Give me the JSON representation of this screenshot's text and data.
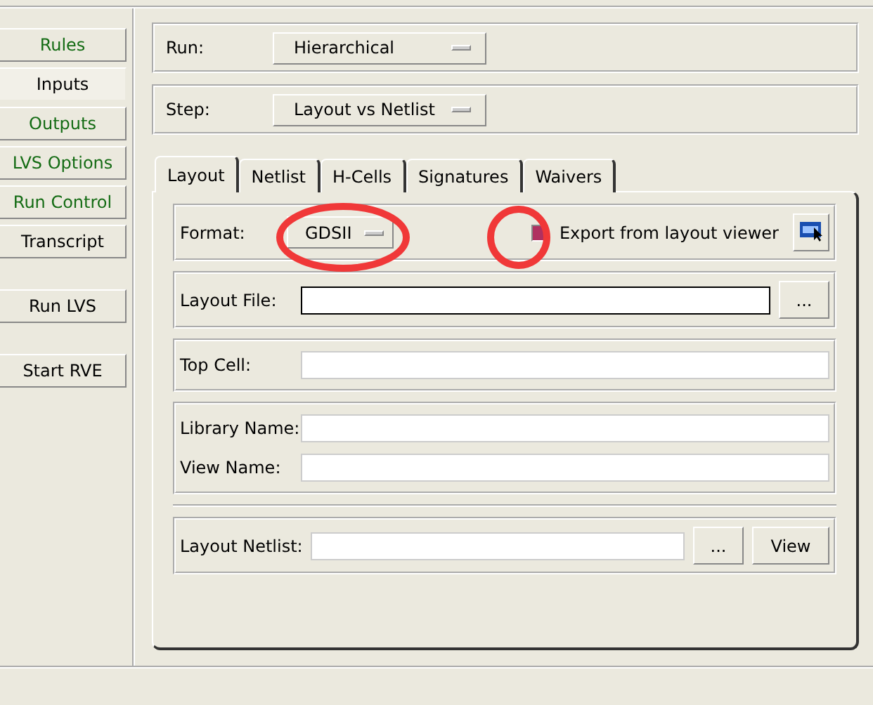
{
  "sidebar": {
    "items": [
      {
        "label": "Rules",
        "selected": false,
        "configured": true
      },
      {
        "label": "Inputs",
        "selected": true,
        "configured": false
      },
      {
        "label": "Outputs",
        "selected": false,
        "configured": true
      },
      {
        "label": "LVS Options",
        "selected": false,
        "configured": true
      },
      {
        "label": "Run Control",
        "selected": false,
        "configured": true
      },
      {
        "label": "Transcript",
        "selected": false,
        "configured": false
      }
    ],
    "actions": [
      "Run LVS",
      "Start RVE"
    ]
  },
  "run": {
    "label": "Run:",
    "value": "Hierarchical"
  },
  "step": {
    "label": "Step:",
    "value": "Layout vs Netlist"
  },
  "tabs": [
    {
      "label": "Layout",
      "selected": true
    },
    {
      "label": "Netlist",
      "selected": false
    },
    {
      "label": "H-Cells",
      "selected": false
    },
    {
      "label": "Signatures",
      "selected": false
    },
    {
      "label": "Waivers",
      "selected": false
    }
  ],
  "layout": {
    "format_label": "Format:",
    "format_value": "GDSII",
    "export_label": "Export from layout viewer",
    "export_checked": true,
    "layout_file_label": "Layout File:",
    "browse": "...",
    "top_cell_label": "Top Cell:",
    "library_label": "Library Name:",
    "view_name_label": "View Name:",
    "netlist_label": "Layout Netlist:",
    "netlist_browse": "...",
    "view_button": "View"
  }
}
